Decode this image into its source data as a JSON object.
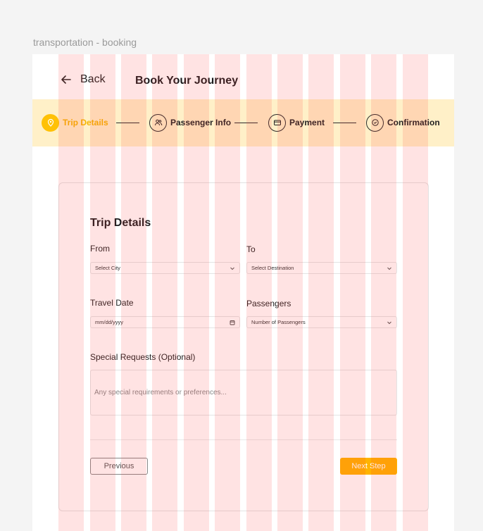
{
  "canvas": {
    "label": "transportation - booking"
  },
  "header": {
    "back_label": "Back",
    "title": "Book Your Journey"
  },
  "stepper": {
    "active_color": "#ffc107",
    "background": "#fff0c8",
    "steps": [
      {
        "label": "Trip Details",
        "icon": "map-pin-icon",
        "active": true
      },
      {
        "label": "Passenger Info",
        "icon": "users-icon",
        "active": false
      },
      {
        "label": "Payment",
        "icon": "credit-card-icon",
        "active": false
      },
      {
        "label": "Confirmation",
        "icon": "check-circle-icon",
        "active": false
      }
    ]
  },
  "form": {
    "title": "Trip Details",
    "from": {
      "label": "From",
      "placeholder": "Select City"
    },
    "to": {
      "label": "To",
      "placeholder": "Select Destination"
    },
    "travel_date": {
      "label": "Travel Date",
      "placeholder": "mm/dd/yyyy"
    },
    "passengers": {
      "label": "Passengers",
      "placeholder": "Number of Passengers"
    },
    "special_requests": {
      "label": "Special Requests (Optional)",
      "placeholder": "Any special requirements or preferences..."
    }
  },
  "actions": {
    "previous_label": "Previous",
    "next_label": "Next Step",
    "next_color": "#ffb300"
  }
}
